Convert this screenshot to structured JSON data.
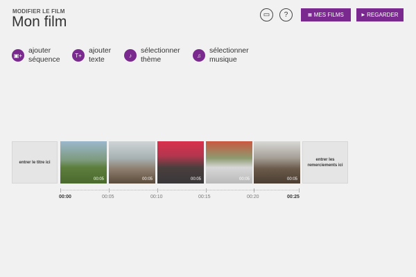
{
  "header": {
    "subtitle": "MODIFIER LE FILM",
    "title": "Mon film",
    "cast_icon_glyph": "▭",
    "help_label": "?",
    "films_label": "MES FILMS",
    "films_icon": "▦",
    "watch_label": "REGARDER",
    "watch_icon": "▶"
  },
  "actions": [
    {
      "icon": "▣+",
      "line1": "ajouter",
      "line2": "séquence"
    },
    {
      "icon": "T+",
      "line1": "ajouter",
      "line2": "texte"
    },
    {
      "icon": "♪",
      "line1": "sélectionner",
      "line2": "thème"
    },
    {
      "icon": "♫",
      "line1": "sélectionner",
      "line2": "musique"
    }
  ],
  "timeline": {
    "title_card": "entrer le titre ici",
    "thanks_card": "entrer les remerciements ici",
    "clips": [
      {
        "duration": "00:05"
      },
      {
        "duration": "00:05"
      },
      {
        "duration": "00:05"
      },
      {
        "duration": "00:05"
      },
      {
        "duration": "00:05"
      }
    ],
    "ticks": [
      "00:00",
      "00:05",
      "00:10",
      "00:15",
      "00:20",
      "00:25"
    ]
  },
  "colors": {
    "accent": "#7a2a8f",
    "background": "#f0f1f0"
  }
}
